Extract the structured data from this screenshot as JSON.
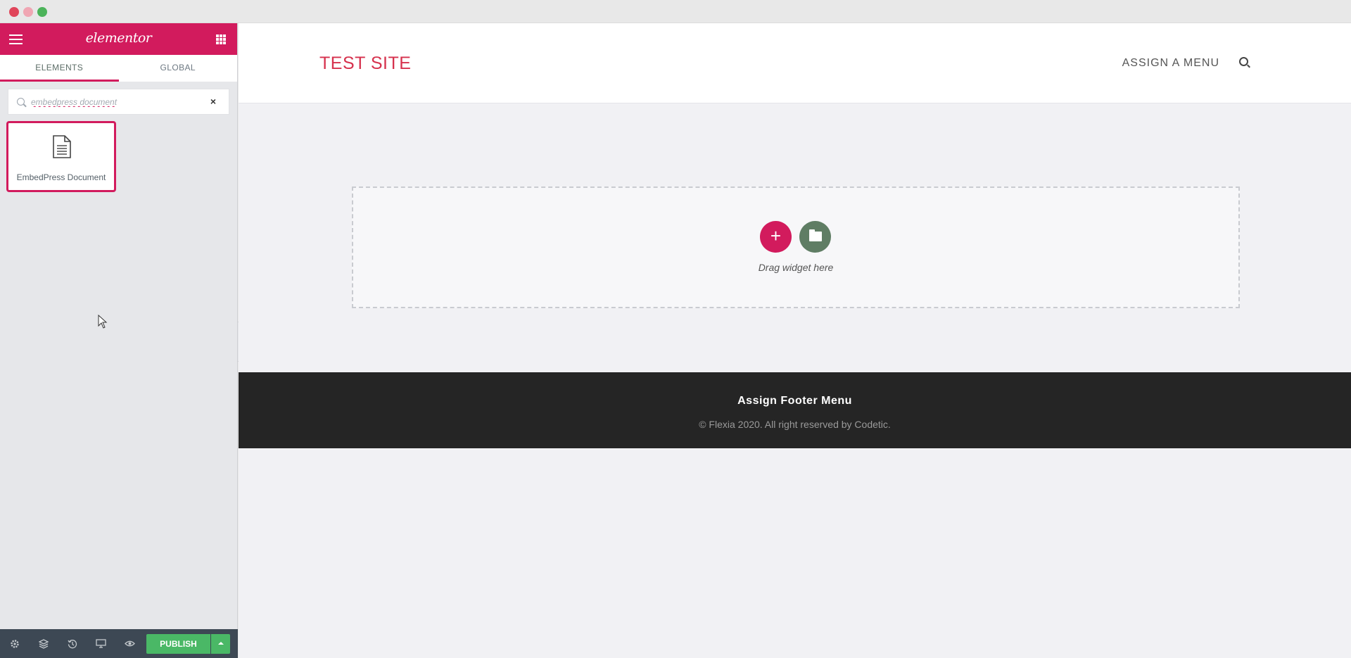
{
  "panel": {
    "logo_text": "elementor",
    "tabs": [
      {
        "label": "ELEMENTS",
        "active": true
      },
      {
        "label": "GLOBAL",
        "active": false
      }
    ],
    "search": {
      "value": "embedpress document",
      "placeholder": "Search Widget..."
    },
    "widgets": [
      {
        "label": "EmbedPress Document",
        "icon": "document-icon"
      }
    ],
    "footer": {
      "icons": [
        "settings-icon",
        "navigator-icon",
        "history-icon",
        "responsive-icon",
        "preview-icon"
      ],
      "publish_label": "PUBLISH"
    }
  },
  "site": {
    "title": "TEST SITE",
    "menu_label": "ASSIGN A MENU"
  },
  "drop_zone": {
    "add_label": "+",
    "text": "Drag widget here"
  },
  "footer": {
    "menu": "Assign Footer Menu",
    "copyright": "© Flexia 2020. All right reserved by Codetic."
  },
  "colors": {
    "brand": "#d21b5d",
    "publish": "#4ab866",
    "template_button": "#5f7d64",
    "footer_bg": "#252525",
    "site_title": "#d6314d"
  }
}
